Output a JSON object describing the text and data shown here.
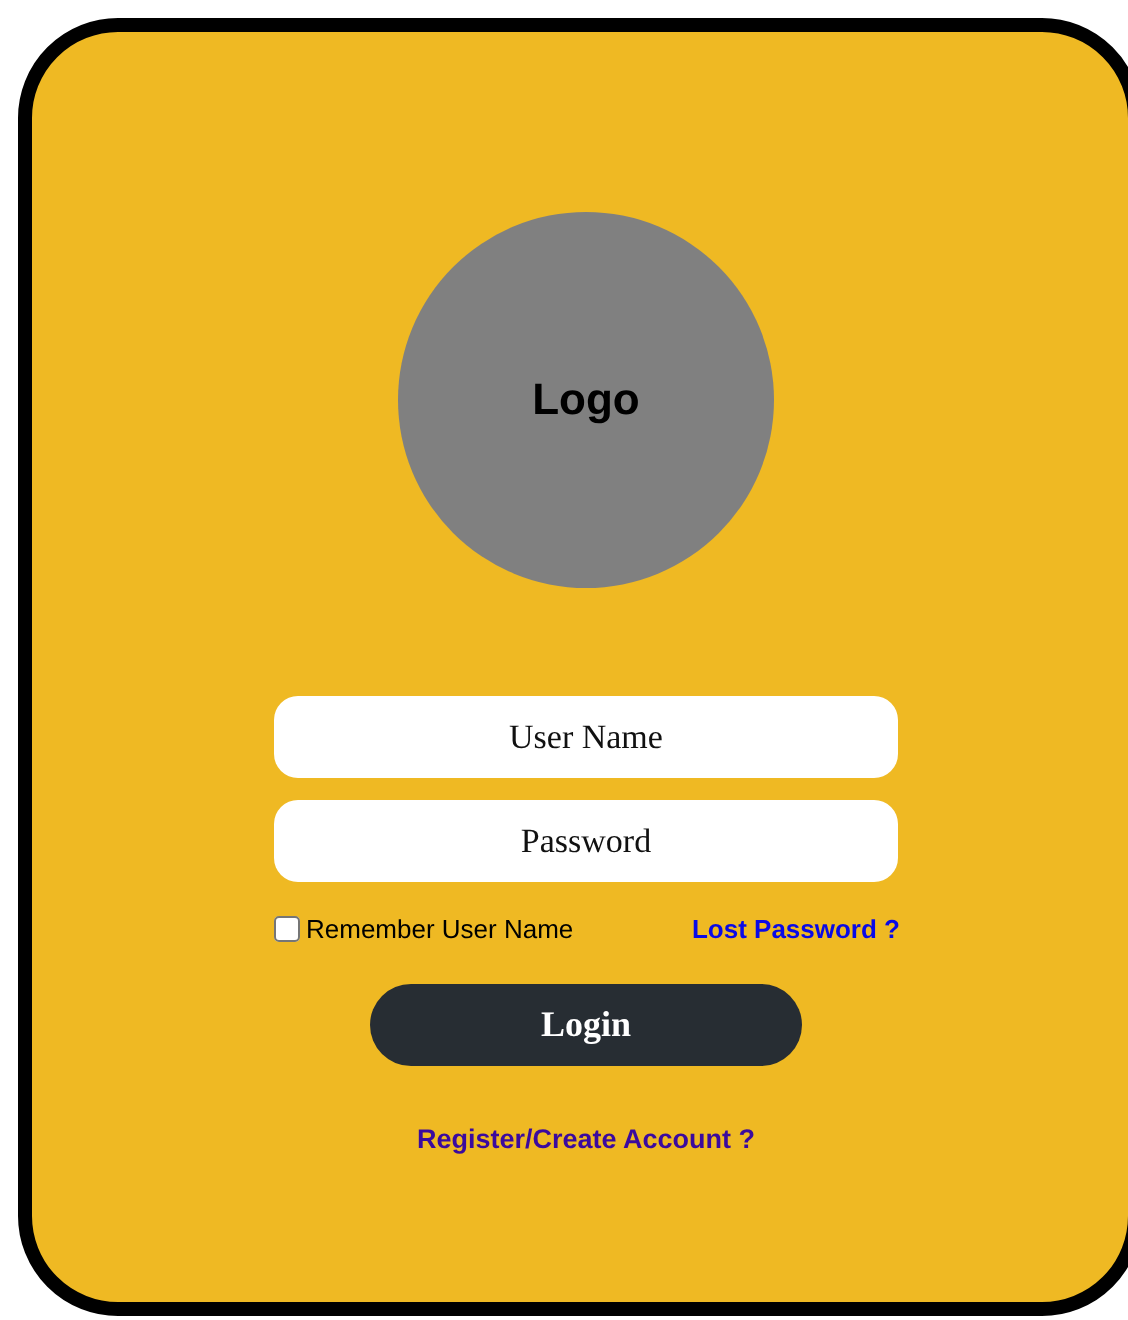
{
  "logo": {
    "text": "Logo"
  },
  "fields": [
    {
      "placeholder": "User Name"
    },
    {
      "placeholder": "Password"
    }
  ],
  "remember": {
    "label": "Remember User Name",
    "checked": false
  },
  "lost_password": "Lost Password ?",
  "login_button": "Login",
  "register_link": "Register/Create Account ?"
}
